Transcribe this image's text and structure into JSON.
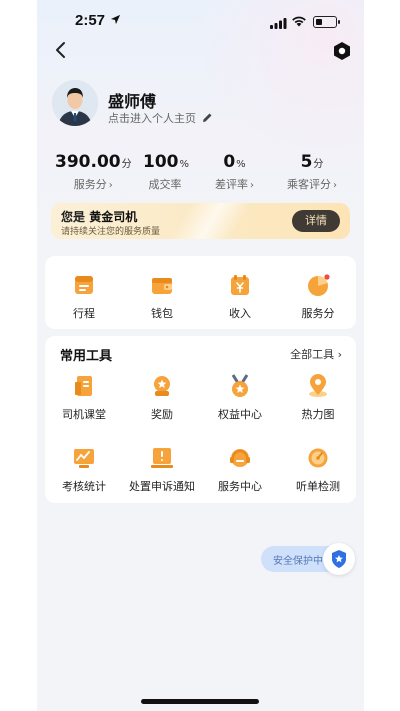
{
  "status": {
    "time": "2:57"
  },
  "profile": {
    "name": "盛师傅",
    "subline": "点击进入个人主页"
  },
  "stats": [
    {
      "value": "390.00",
      "unit": "分",
      "label": "服务分",
      "arrow": "›"
    },
    {
      "value": "100",
      "unit": "%",
      "label": "成交率",
      "arrow": ""
    },
    {
      "value": "0",
      "unit": "%",
      "label": "差评率",
      "arrow": "›"
    },
    {
      "value": "5",
      "unit": "分",
      "label": "乘客评分",
      "arrow": "›"
    }
  ],
  "gold_banner": {
    "prefix": "您是",
    "level": "黄金司机",
    "subtitle": "请持续关注您的服务质量",
    "button": "详情"
  },
  "main_actions": [
    {
      "label": "行程",
      "icon": "itinerary-icon"
    },
    {
      "label": "钱包",
      "icon": "wallet-icon"
    },
    {
      "label": "收入",
      "icon": "income-icon"
    },
    {
      "label": "服务分",
      "icon": "service-score-icon"
    }
  ],
  "tools": {
    "title": "常用工具",
    "more": "全部工具",
    "items": [
      {
        "label": "司机课堂",
        "icon": "driver-class-icon"
      },
      {
        "label": "奖励",
        "icon": "reward-icon"
      },
      {
        "label": "权益中心",
        "icon": "benefits-icon"
      },
      {
        "label": "热力图",
        "icon": "heatmap-icon"
      },
      {
        "label": "考核统计",
        "icon": "assessment-stats-icon"
      },
      {
        "label": "处置申诉通知",
        "icon": "appeal-notice-icon"
      },
      {
        "label": "服务中心",
        "icon": "service-center-icon"
      },
      {
        "label": "听单检测",
        "icon": "order-listening-test-icon"
      }
    ]
  },
  "safety": {
    "label": "安全保护中"
  },
  "colors": {
    "accent_orange": "#f49a2c",
    "safety_blue": "#2f6fe4",
    "gold_button": "#3f3a34"
  }
}
